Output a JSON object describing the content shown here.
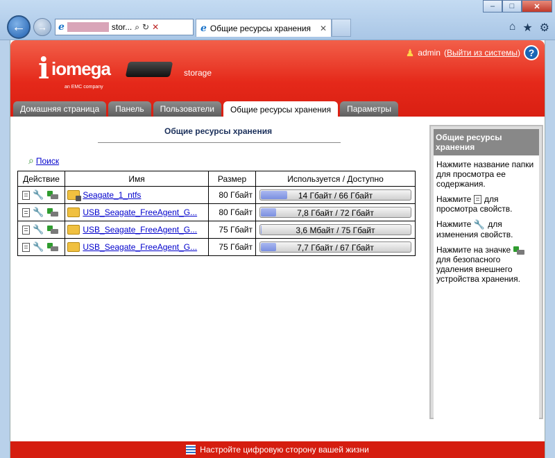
{
  "browser": {
    "address_text": "stor...",
    "tab_title": "Общие ресурсы хранения",
    "win_minimize": "–",
    "win_maximize": "□",
    "win_close": "✕",
    "icons": [
      "home-icon",
      "favorites-star-icon",
      "tools-gear-icon"
    ]
  },
  "header": {
    "logo_word": "iomega",
    "logo_sub": "an EMC company",
    "device_name": "storage",
    "user": "admin",
    "logout_prefix": "(",
    "logout_label": "Выйти из системы",
    "logout_suffix": ")",
    "help": "?"
  },
  "nav": {
    "tabs": [
      {
        "label": "Домашняя страница"
      },
      {
        "label": "Панель"
      },
      {
        "label": "Пользователи"
      },
      {
        "label": "Общие ресурсы хранения",
        "active": true
      },
      {
        "label": "Параметры"
      }
    ]
  },
  "main": {
    "title": "Общие ресурсы хранения",
    "search_label": "Поиск",
    "columns": [
      "Действие",
      "Имя",
      "Размер",
      "Используется / Доступно"
    ],
    "rows": [
      {
        "name": "Seagate_1_ntfs",
        "size": "80 Гбайт",
        "usage": "14 Гбайт / 66 Гбайт",
        "used_fraction": 0.175
      },
      {
        "name": "USB_Seagate_FreeAgent_G...",
        "size": "80 Гбайт",
        "usage": "7,8 Гбайт / 72 Гбайт",
        "used_fraction": 0.1
      },
      {
        "name": "USB_Seagate_FreeAgent_G...",
        "size": "75 Гбайт",
        "usage": "3,6 Мбайт / 75 Гбайт",
        "used_fraction": 0.0
      },
      {
        "name": "USB_Seagate_FreeAgent_G...",
        "size": "75 Гбайт",
        "usage": "7,7 Гбайт / 67 Гбайт",
        "used_fraction": 0.1
      }
    ]
  },
  "sidebar": {
    "title": "Общие ресурсы хранения",
    "p1": "Нажмите название папки для просмотра ее содержания.",
    "p2a": "Нажмите",
    "p2b": "для просмотра свойств.",
    "p3a": "Нажмите",
    "p3b": "для изменения свойств.",
    "p4a": "Нажмите на значке",
    "p4b": "для безопасного удаления внешнего устройства хранения."
  },
  "footer": {
    "text": "Настройте цифровую сторону вашей жизни"
  },
  "colors": {
    "brand_red": "#e5291a",
    "tab_grey": "#6e6e6e",
    "link_blue": "#0000cc",
    "bar_fill": "#8a9be6"
  }
}
